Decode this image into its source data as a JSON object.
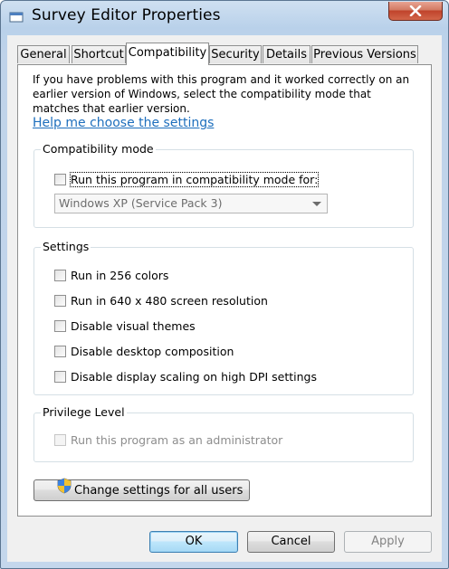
{
  "window": {
    "title": "Survey Editor Properties"
  },
  "tabs": [
    {
      "label": "General",
      "active": false
    },
    {
      "label": "Shortcut",
      "active": false
    },
    {
      "label": "Compatibility",
      "active": true
    },
    {
      "label": "Security",
      "active": false
    },
    {
      "label": "Details",
      "active": false
    },
    {
      "label": "Previous Versions",
      "active": false
    }
  ],
  "compatibility": {
    "intro": "If you have problems with this program and it worked correctly on an earlier version of Windows, select the compatibility mode that matches that earlier version.",
    "help_link": "Help me choose the settings",
    "mode_group": {
      "label": "Compatibility mode",
      "checkbox_label": "Run this program in compatibility mode for:",
      "checked": false,
      "selected_os": "Windows XP (Service Pack 3)"
    },
    "settings_group": {
      "label": "Settings",
      "options": [
        {
          "label": "Run in 256 colors",
          "checked": false
        },
        {
          "label": "Run in 640 x 480 screen resolution",
          "checked": false
        },
        {
          "label": "Disable visual themes",
          "checked": false
        },
        {
          "label": "Disable desktop composition",
          "checked": false
        },
        {
          "label": "Disable display scaling on high DPI settings",
          "checked": false
        }
      ]
    },
    "privilege_group": {
      "label": "Privilege Level",
      "checkbox_label": "Run this program as an administrator",
      "checked": false,
      "enabled": false
    },
    "change_all_users_button": "Change settings for all users"
  },
  "footer": {
    "ok": "OK",
    "cancel": "Cancel",
    "apply": "Apply"
  },
  "icons": {
    "window": "application-icon",
    "uac": "uac-shield-icon",
    "close": "close-icon"
  }
}
